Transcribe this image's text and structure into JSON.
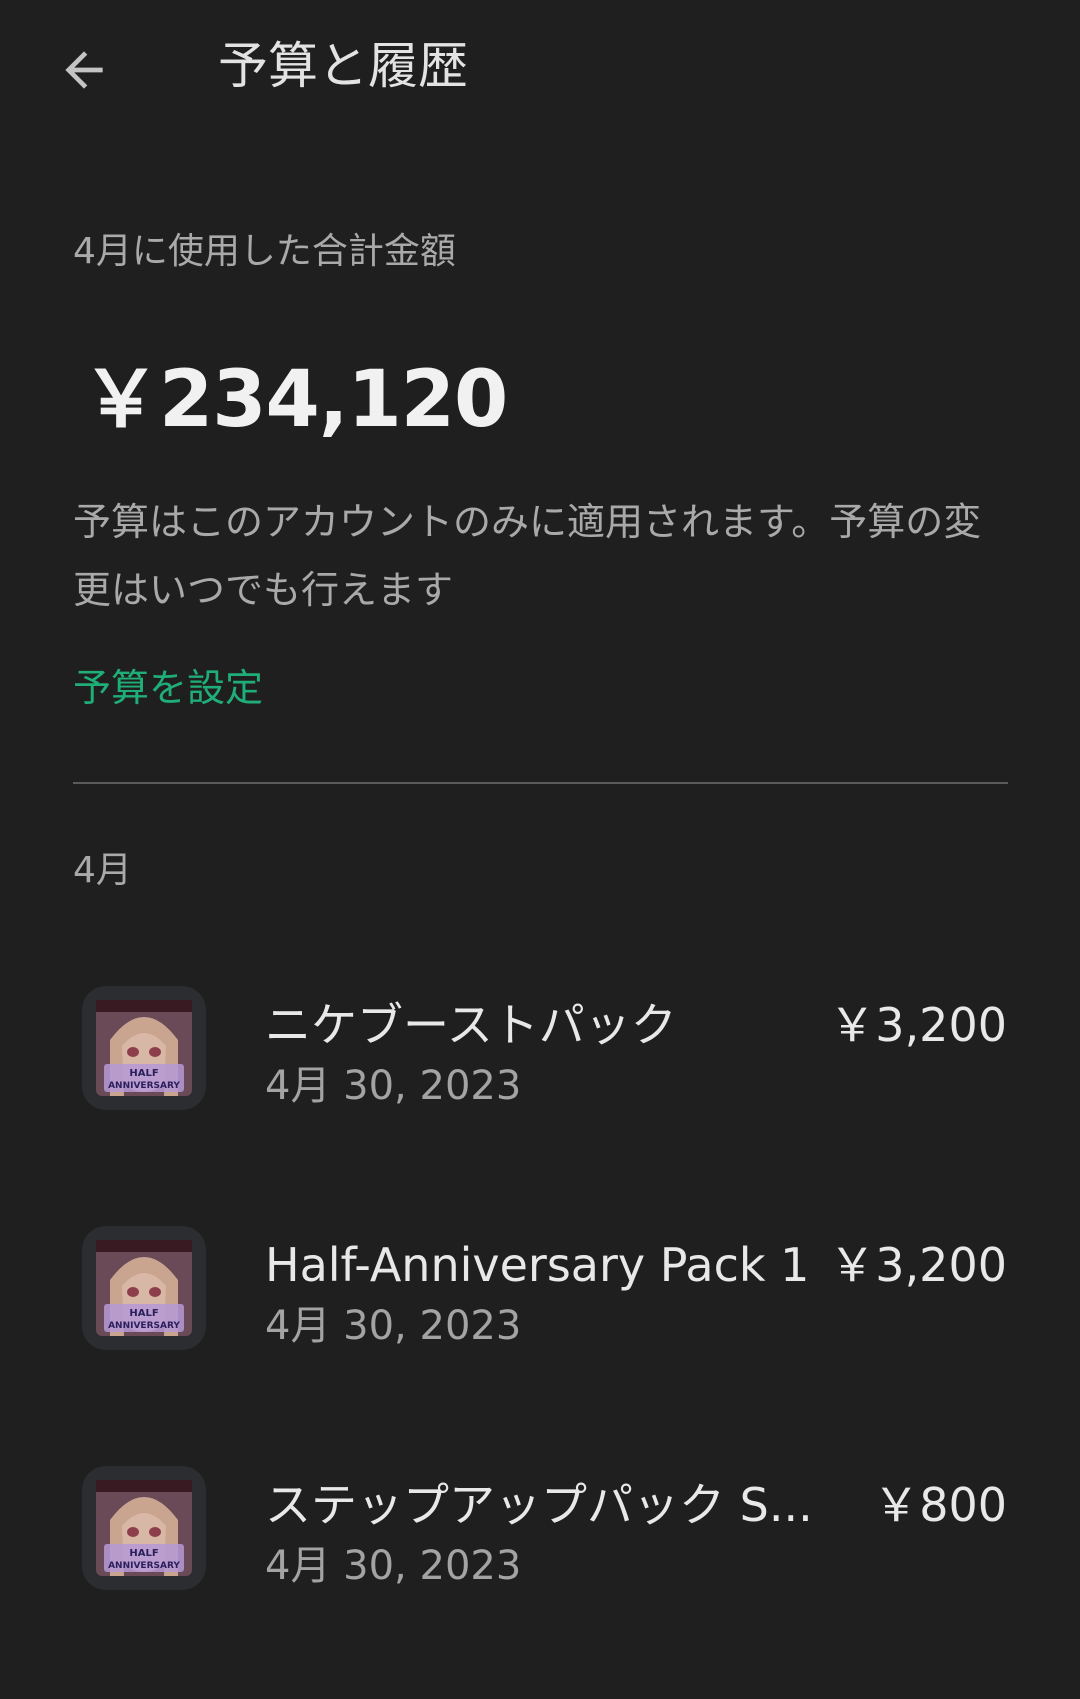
{
  "header": {
    "title": "予算と履歴",
    "back_icon": "arrow-back-icon"
  },
  "summary": {
    "label": "4月に使用した合計金額",
    "total": "￥234,120",
    "note": "予算はこのアカウントのみに適用されます。予算の変更はいつでも行えます",
    "set_budget_label": "予算を設定"
  },
  "history": {
    "month_header": "4月",
    "items": [
      {
        "name": "ニケブーストパック",
        "date": "4月 30, 2023",
        "price": "￥3,200",
        "thumb_text": "HALF ANNIVERSARY"
      },
      {
        "name": "Half-Anniversary Pack 1",
        "date": "4月 30, 2023",
        "price": "￥3,200",
        "thumb_text": "HALF ANNIVERSARY"
      },
      {
        "name": "ステップアップパック S...",
        "date": "4月 30, 2023",
        "price": "￥800",
        "thumb_text": "HALF ANNIVERSARY"
      }
    ]
  },
  "colors": {
    "background": "#1f1f1f",
    "accent_green": "#1fad78",
    "text_primary": "#e3e3e3",
    "text_secondary": "#a9a9a9"
  }
}
